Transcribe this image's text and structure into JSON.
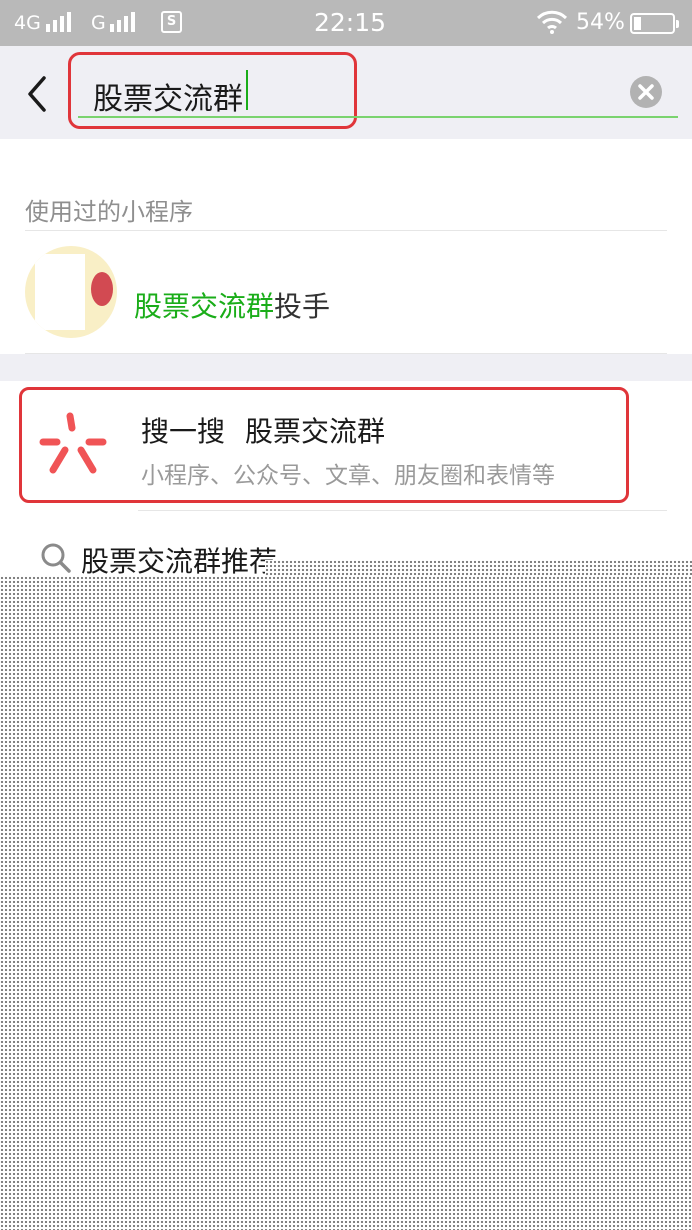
{
  "status_bar": {
    "network_1": "4G",
    "network_2": "G",
    "sim_label": "S",
    "time": "22:15",
    "battery": "54%"
  },
  "search": {
    "query": "股票交流群"
  },
  "used_section": {
    "label": "使用过的小程序",
    "items": [
      {
        "name_highlight": "股票交流群",
        "name_rest": "投手"
      }
    ]
  },
  "souyisou": {
    "title": "搜一搜",
    "query": "股票交流群",
    "subtitle": "小程序、公众号、文章、朋友圈和表情等"
  },
  "suggestion": {
    "text": "股票交流群推荐"
  },
  "colors": {
    "accent_green": "#1aad19",
    "highlight_red": "#e0353a",
    "souyisou_red": "#f05456"
  }
}
